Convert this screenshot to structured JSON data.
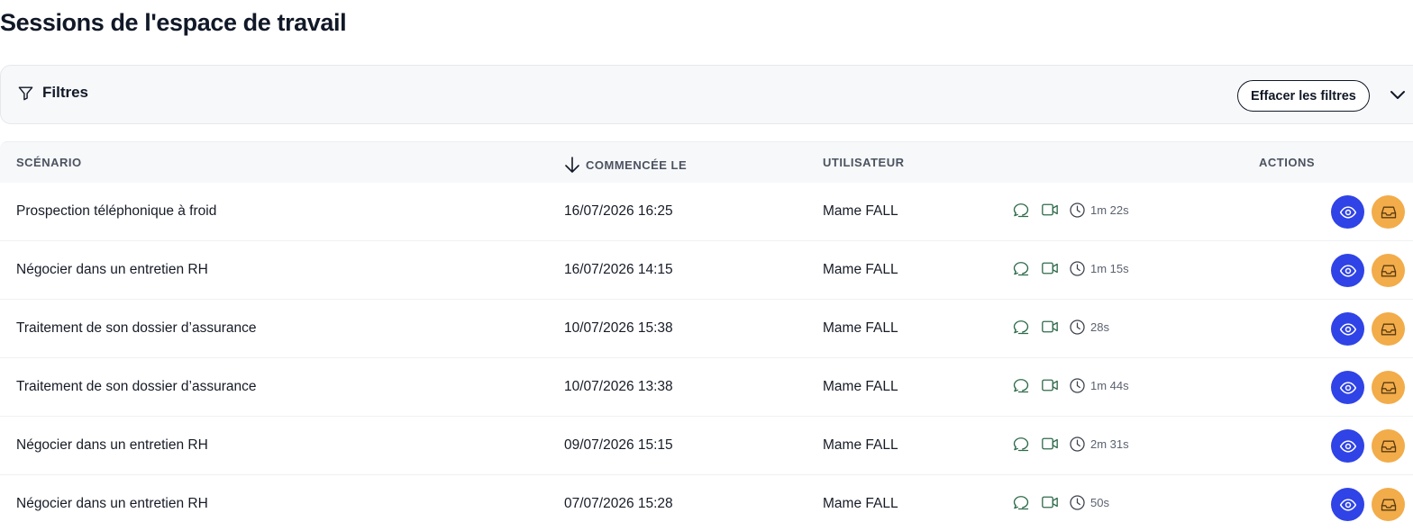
{
  "page": {
    "title": "Sessions de l'espace de travail"
  },
  "filters": {
    "label": "Filtres",
    "clear_label": "Effacer les filtres",
    "icon": "filter-icon",
    "collapse_icon": "chevron-down-icon"
  },
  "table": {
    "columns": {
      "scenario": "SCÉNARIO",
      "started_at": "COMMENCÉE LE",
      "user": "UTILISATEUR",
      "actions": "ACTIONS"
    },
    "sort": {
      "column": "started_at",
      "direction": "desc",
      "icon": "arrow-down-icon"
    },
    "rows": [
      {
        "scenario": "Prospection téléphonique à froid",
        "started_at": "16/07/2026 16:25",
        "user": "Mame FALL",
        "duration": "1m 22s"
      },
      {
        "scenario": "Négocier dans un entretien RH",
        "started_at": "16/07/2026 14:15",
        "user": "Mame FALL",
        "duration": "1m 15s"
      },
      {
        "scenario": "Traitement de son dossier d’assurance",
        "started_at": "10/07/2026 15:38",
        "user": "Mame FALL",
        "duration": "28s"
      },
      {
        "scenario": "Traitement de son dossier d’assurance",
        "started_at": "10/07/2026 13:38",
        "user": "Mame FALL",
        "duration": "1m 44s"
      },
      {
        "scenario": "Négocier dans un entretien RH",
        "started_at": "09/07/2026 15:15",
        "user": "Mame FALL",
        "duration": "2m 31s"
      },
      {
        "scenario": "Négocier dans un entretien RH",
        "started_at": "07/07/2026 15:28",
        "user": "Mame FALL",
        "duration": "50s"
      }
    ]
  },
  "row_icons": [
    "chat-icon",
    "video-icon",
    "clock-icon",
    "eye-icon",
    "inbox-icon"
  ],
  "colors": {
    "view_button": "#2f43e6",
    "archive_button": "#f2ac4a",
    "meta_icons": "#2f6b4a",
    "header_bg": "#f7f8fa"
  }
}
